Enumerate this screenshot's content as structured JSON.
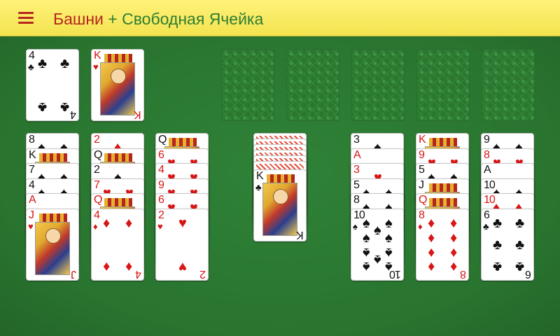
{
  "header": {
    "title_part1": "Башни",
    "title_separator": "+",
    "title_part2": "Свободная Ячейка",
    "menu_icon": "hamburger-menu-icon"
  },
  "colors": {
    "header_bg": "#f3e34f",
    "table_bg": "#2f7a33",
    "accent_red": "#b5261e",
    "accent_green": "#2e7d32"
  },
  "free_cells": [
    {
      "rank": "4",
      "suit": "♣"
    },
    {
      "rank": "K",
      "suit": "♥"
    }
  ],
  "foundations_empty": 5,
  "stock": {
    "covered_count": 6,
    "top": {
      "rank": "K",
      "suit": "♣"
    }
  },
  "tableau": [
    {
      "cards": [
        {
          "rank": "8",
          "suit": "♠"
        },
        {
          "rank": "K",
          "suit": "♠"
        },
        {
          "rank": "7",
          "suit": "♠"
        },
        {
          "rank": "4",
          "suit": "♠"
        },
        {
          "rank": "A",
          "suit": "♥"
        },
        {
          "rank": "J",
          "suit": "♥"
        }
      ]
    },
    {
      "cards": [
        {
          "rank": "2",
          "suit": "♦"
        },
        {
          "rank": "Q",
          "suit": "♠"
        },
        {
          "rank": "2",
          "suit": "♠"
        },
        {
          "rank": "7",
          "suit": "♥"
        },
        {
          "rank": "Q",
          "suit": "♥"
        },
        {
          "rank": "4",
          "suit": "♦"
        }
      ]
    },
    {
      "cards": [
        {
          "rank": "Q",
          "suit": "♠"
        },
        {
          "rank": "6",
          "suit": "♥"
        },
        {
          "rank": "4",
          "suit": "♥"
        },
        {
          "rank": "9",
          "suit": "♥"
        },
        {
          "rank": "6",
          "suit": "♥"
        },
        {
          "rank": "2",
          "suit": "♥"
        }
      ]
    },
    {
      "cards": [
        {
          "rank": "3",
          "suit": "♠"
        },
        {
          "rank": "A",
          "suit": "♥"
        },
        {
          "rank": "3",
          "suit": "♥"
        },
        {
          "rank": "5",
          "suit": "♠"
        },
        {
          "rank": "8",
          "suit": "♠"
        },
        {
          "rank": "10",
          "suit": "♠"
        }
      ]
    },
    {
      "cards": [
        {
          "rank": "K",
          "suit": "♦"
        },
        {
          "rank": "9",
          "suit": "♥"
        },
        {
          "rank": "5",
          "suit": "♠"
        },
        {
          "rank": "J",
          "suit": "♠"
        },
        {
          "rank": "Q",
          "suit": "♦"
        },
        {
          "rank": "8",
          "suit": "♦"
        }
      ]
    },
    {
      "cards": [
        {
          "rank": "9",
          "suit": "♠"
        },
        {
          "rank": "8",
          "suit": "♥"
        },
        {
          "rank": "A",
          "suit": "♠"
        },
        {
          "rank": "10",
          "suit": "♠"
        },
        {
          "rank": "10",
          "suit": "♦"
        },
        {
          "rank": "6",
          "suit": "♣"
        }
      ]
    }
  ]
}
